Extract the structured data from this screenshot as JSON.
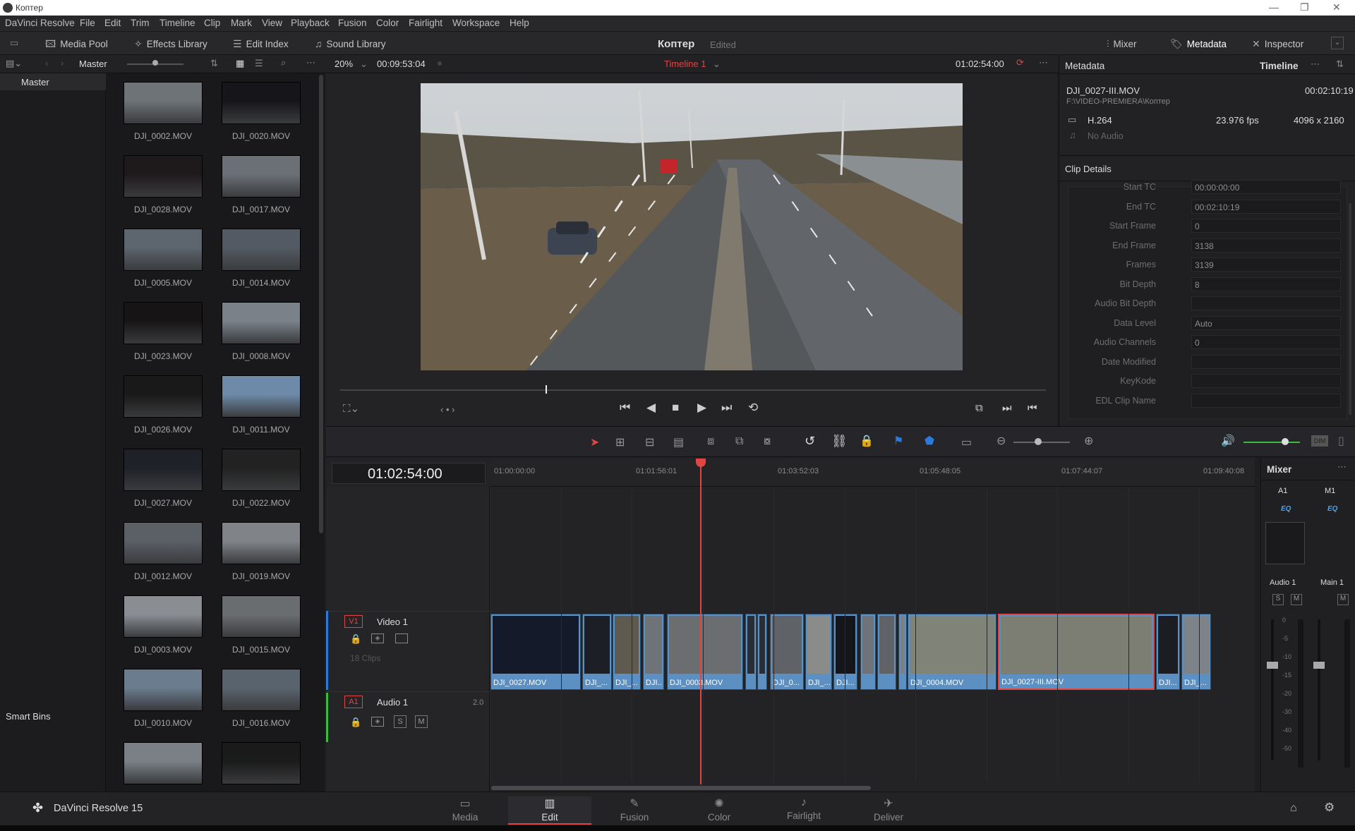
{
  "window": {
    "title": "Коптер"
  },
  "menu": [
    "DaVinci Resolve",
    "File",
    "Edit",
    "Trim",
    "Timeline",
    "Clip",
    "Mark",
    "View",
    "Playback",
    "Fusion",
    "Color",
    "Fairlight",
    "Workspace",
    "Help"
  ],
  "toolbar": {
    "media_pool": "Media Pool",
    "effects_library": "Effects Library",
    "edit_index": "Edit Index",
    "sound_library": "Sound Library",
    "project_name": "Коптер",
    "project_state": "Edited",
    "mixer": "Mixer",
    "metadata": "Metadata",
    "inspector": "Inspector"
  },
  "subbar": {
    "bin": "Master",
    "zoom": "20%",
    "duration": "00:09:53:04",
    "timeline_name": "Timeline 1",
    "timecode": "01:02:54:00"
  },
  "bins": {
    "master": "Master",
    "smart_bins": "Smart Bins"
  },
  "clips": [
    "DJI_0002.MOV",
    "DJI_0020.MOV",
    "DJI_0028.MOV",
    "DJI_0017.MOV",
    "DJI_0005.MOV",
    "DJI_0014.MOV",
    "DJI_0023.MOV",
    "DJI_0008.MOV",
    "DJI_0026.MOV",
    "DJI_0011.MOV",
    "DJI_0027.MOV",
    "DJI_0022.MOV",
    "DJI_0012.MOV",
    "DJI_0019.MOV",
    "DJI_0003.MOV",
    "DJI_0015.MOV",
    "DJI_0010.MOV",
    "DJI_0016.MOV",
    "",
    ""
  ],
  "metadata": {
    "panel_title": "Metadata",
    "tab": "Timeline",
    "clip_name": "DJI_0027-III.MOV",
    "clip_duration": "00:02:10:19",
    "clip_path": "F:\\VIDEO-PREMIERA\\Коптер",
    "codec": "H.264",
    "fps": "23.976 fps",
    "resolution": "4096 x 2160",
    "audio": "No Audio",
    "section": "Clip Details",
    "fields": [
      {
        "label": "Start TC",
        "value": "00:00:00:00"
      },
      {
        "label": "End TC",
        "value": "00:02:10:19"
      },
      {
        "label": "Start Frame",
        "value": "0"
      },
      {
        "label": "End Frame",
        "value": "3138"
      },
      {
        "label": "Frames",
        "value": "3139"
      },
      {
        "label": "Bit Depth",
        "value": "8"
      },
      {
        "label": "Audio Bit Depth",
        "value": ""
      },
      {
        "label": "Data Level",
        "value": "Auto"
      },
      {
        "label": "Audio Channels",
        "value": "0"
      },
      {
        "label": "Date Modified",
        "value": ""
      },
      {
        "label": "KeyKode",
        "value": ""
      },
      {
        "label": "EDL Clip Name",
        "value": ""
      }
    ]
  },
  "timeline": {
    "timecode": "01:02:54:00",
    "ruler": [
      "01:00:00:00",
      "01:01:56:01",
      "01:03:52:03",
      "01:05:48:05",
      "01:07:44:07",
      "01:09:40:08"
    ],
    "video_track": {
      "id": "V1",
      "name": "Video 1",
      "clips_count": "18 Clips"
    },
    "audio_track": {
      "id": "A1",
      "name": "Audio 1",
      "channels": "2.0",
      "solo": "S",
      "mute": "M"
    },
    "clips": [
      "DJI_0027.MOV",
      "DJI_...",
      "DJI_...",
      "DJI...",
      "DJI_0003.MOV",
      "",
      "",
      "DJI_0...",
      "DJI_...",
      "DJI...",
      "",
      "",
      "",
      "DJI_0004.MOV",
      "DJI_0027-III.MOV",
      "DJI...",
      "DJI_..."
    ]
  },
  "mixer": {
    "title": "Mixer",
    "ch1": "A1",
    "ch2": "M1",
    "eq": "EQ",
    "ch1_name": "Audio 1",
    "ch2_name": "Main 1",
    "solo": "S",
    "mute": "M",
    "scale": [
      "0",
      "-5",
      "-10",
      "-15",
      "-20",
      "-30",
      "-40",
      "-50"
    ]
  },
  "pages": [
    "Media",
    "Edit",
    "Fusion",
    "Color",
    "Fairlight",
    "Deliver"
  ],
  "app_name": "DaVinci Resolve 15",
  "colors": {
    "accent_red": "#e04646",
    "clip_blue": "#5c8fc2",
    "active_page": "#e04646"
  }
}
